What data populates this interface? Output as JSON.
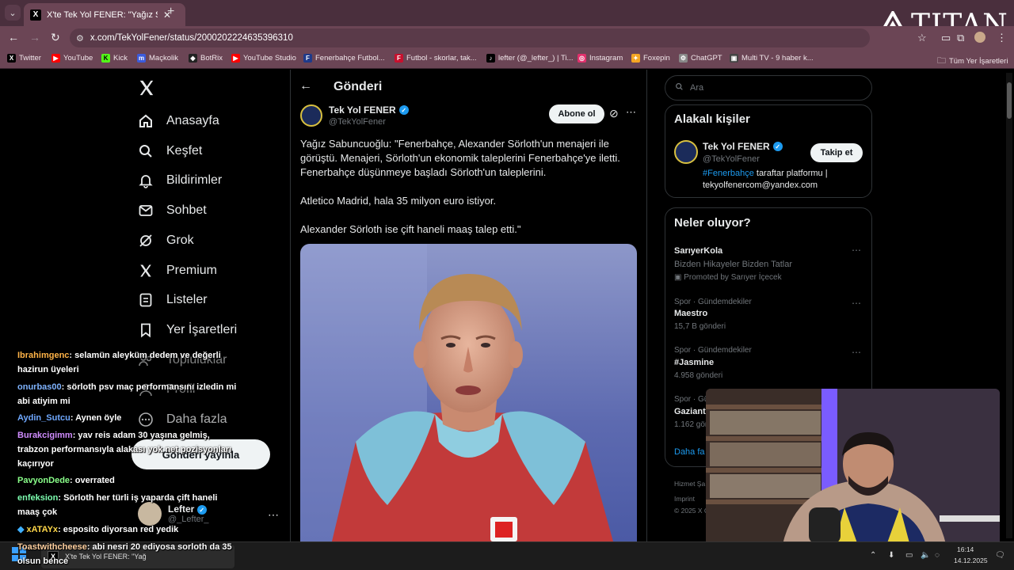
{
  "browser": {
    "tab_title": "X'te Tek Yol FENER: \"Yağız Sabu",
    "url": "x.com/TekYolFener/status/2000202224635396310",
    "bookmarks": [
      {
        "label": "Twitter",
        "icon": "x-icon",
        "color": "#000000"
      },
      {
        "label": "YouTube",
        "icon": "youtube-icon",
        "color": "#ff0000"
      },
      {
        "label": "Kick",
        "icon": "kick-icon",
        "color": "#53fc18"
      },
      {
        "label": "Maçkolik",
        "icon": "mackolik-icon",
        "color": "#3b5bdb"
      },
      {
        "label": "BotRix",
        "icon": "botrix-icon",
        "color": "#222222"
      },
      {
        "label": "YouTube Studio",
        "icon": "youtube-studio-icon",
        "color": "#ff0000"
      },
      {
        "label": "Fenerbahçe Futbol...",
        "icon": "fenerbahce-icon",
        "color": "#1e3a8a"
      },
      {
        "label": "Futbol - skorlar, tak...",
        "icon": "flashscore-icon",
        "color": "#c8102e"
      },
      {
        "label": "lefter (@_lefter_) | Ti...",
        "icon": "tiktok-icon",
        "color": "#000000"
      },
      {
        "label": "Instagram",
        "icon": "instagram-icon",
        "color": "#e1306c"
      },
      {
        "label": "Foxepin",
        "icon": "foxepin-icon",
        "color": "#f5a623"
      },
      {
        "label": "ChatGPT",
        "icon": "chatgpt-icon",
        "color": "#888888"
      },
      {
        "label": "Multi TV - 9 haber k...",
        "icon": "multitv-icon",
        "color": "#444444"
      }
    ],
    "all_bookmarks": "Tüm Yer İşaretleri"
  },
  "overlay": {
    "logo_text": "TITAN"
  },
  "sidebar": {
    "items": [
      {
        "label": "Anasayfa",
        "icon": "home-icon"
      },
      {
        "label": "Keşfet",
        "icon": "search-icon"
      },
      {
        "label": "Bildirimler",
        "icon": "bell-icon"
      },
      {
        "label": "Sohbet",
        "icon": "mail-icon"
      },
      {
        "label": "Grok",
        "icon": "grok-icon"
      },
      {
        "label": "Premium",
        "icon": "x-icon"
      },
      {
        "label": "Listeler",
        "icon": "list-icon"
      },
      {
        "label": "Yer İşaretleri",
        "icon": "bookmark-icon"
      },
      {
        "label": "Topluluklar",
        "icon": "community-icon"
      },
      {
        "label": "Profil",
        "icon": "person-icon"
      },
      {
        "label": "Daha fazla",
        "icon": "more-circle-icon"
      }
    ],
    "post_button": "Gönderi yayınla",
    "account_name": "Lefter",
    "account_handle": "@_Lefter_"
  },
  "post": {
    "header": "Gönderi",
    "author_name": "Tek Yol FENER",
    "author_handle": "@TekYolFener",
    "subscribe_label": "Abone ol",
    "paragraphs": [
      "Yağız Sabuncuoğlu: \"Fenerbahçe, Alexander Sörloth'un menajeri ile görüştü. Menajeri, Sörloth'un ekonomik taleplerini Fenerbahçe'ye iletti. Fenerbahçe düşünmeye başladı Sörloth'un taleplerini.",
      "Atletico Madrid, hala 35 milyon euro istiyor.",
      "Alexander Sörloth ise çift haneli maaş talep etti.\""
    ]
  },
  "right": {
    "search_placeholder": "Ara",
    "related_title": "Alakalı kişiler",
    "related_name": "Tek Yol FENER",
    "related_handle": "@TekYolFener",
    "follow_label": "Takip et",
    "related_bio_tag": "#Fenerbahçe",
    "related_bio_rest": " taraftar platformu | tekyolfenercom@yandex.com",
    "trends_title": "Neler oluyor?",
    "trends": [
      {
        "small": "",
        "title": "SarıyerKola",
        "sub": "Bizden Hikayeler Bizden Tatlar",
        "meta": "Promoted by Sarıyer İçecek"
      },
      {
        "small": "Spor · Gündemdekiler",
        "title": "Maestro",
        "meta": "15,7 B gönderi"
      },
      {
        "small": "Spor · Gündemdekiler",
        "title": "#Jasmine",
        "meta": "4.958 gönderi"
      },
      {
        "small": "Spor · Gün",
        "title": "Gaziant",
        "meta": "1.162 gön"
      }
    ],
    "show_more": "Daha fa",
    "footer": [
      "Hizmet Şa",
      "Imprint",
      "© 2025 X C"
    ]
  },
  "chat": [
    {
      "user": "Ibrahimgenc",
      "color": "#ffb347",
      "text": ": selamün aleyküm dedem ve değerli hazirun üyeleri"
    },
    {
      "user": "onurbas00",
      "color": "#7fb3ff",
      "text": ": sörloth psv maç performansını izledin mi abi atiyim mi"
    },
    {
      "user": "Aydin_Sutcu",
      "color": "#6fa8ff",
      "text": ": Aynen öyle"
    },
    {
      "user": "Burakcigimm",
      "color": "#d08cff",
      "text": ": yav reis adam 30 yaşına gelmiş, trabzon performansıyla alakası yok net pozisyonları kaçırıyor"
    },
    {
      "user": "PavyonDede",
      "color": "#8aff8a",
      "text": ": overrated"
    },
    {
      "user": "enfeksion",
      "color": "#7dffb0",
      "text": ": Sörloth her türli iş yaparda çift haneli maaş çok"
    },
    {
      "user": "xATAYx",
      "color": "#ffd84a",
      "text": ": esposito diyorsan red yedik"
    },
    {
      "user": "Toastwithcheese",
      "color": "#ffd0a0",
      "text": ": abi nesri 20 ediyosa sorloth da 35 olsun bence"
    }
  ],
  "taskbar": {
    "app_label": "X'te Tek Yol FENER: \"Yağ",
    "time": "16:14",
    "date": "14.12.2025"
  }
}
